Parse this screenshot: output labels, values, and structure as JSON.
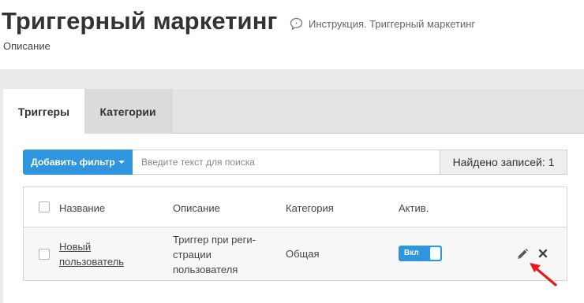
{
  "header": {
    "title": "Триггерный маркетинг",
    "help_link": "Инструкция. Триггерный маркетинг",
    "help_icon": "speech-bubble-icon",
    "description": "Описание"
  },
  "tabs": [
    {
      "label": "Триггеры",
      "active": true
    },
    {
      "label": "Категории",
      "active": false
    }
  ],
  "filter": {
    "add_filter_label": "Добавить фильтр",
    "search_placeholder": "Введите текст для поиска",
    "records_found": "Найдено записей: 1"
  },
  "table": {
    "columns": [
      "Название",
      "Описание",
      "Категория",
      "Актив."
    ],
    "rows": [
      {
        "name_line1": "Новый",
        "name_line2": "пользователь",
        "desc_line1": "Триггер при реги-",
        "desc_line2": "страции",
        "desc_line3": "пользователя",
        "category": "Общая",
        "active_label": "Вкл",
        "active": true
      }
    ]
  },
  "colors": {
    "accent": "#2f95df",
    "annotation_arrow": "#e8191b"
  },
  "icons": {
    "edit": "pencil-icon",
    "delete": "close-icon",
    "annotation": "red-arrow-icon"
  }
}
